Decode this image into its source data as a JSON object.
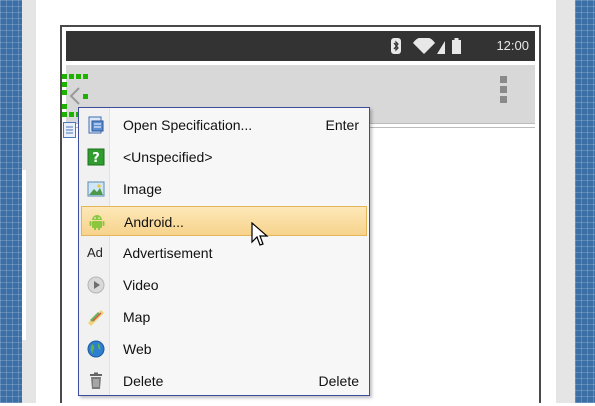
{
  "status_bar": {
    "clock": "12:00"
  },
  "context_menu": {
    "items": [
      {
        "label": "Open Specification...",
        "shortcut": "Enter",
        "icon": "specification-icon"
      },
      {
        "label": "<Unspecified>",
        "shortcut": "",
        "icon": "question-icon"
      },
      {
        "label": "Image",
        "shortcut": "",
        "icon": "image-icon"
      },
      {
        "label": "Android...",
        "shortcut": "",
        "icon": "android-icon",
        "highlighted": true
      },
      {
        "label": "Advertisement",
        "shortcut": "",
        "icon": "ad-icon",
        "icon_text": "Ad"
      },
      {
        "label": "Video",
        "shortcut": "",
        "icon": "play-icon"
      },
      {
        "label": "Map",
        "shortcut": "",
        "icon": "map-icon"
      },
      {
        "label": "Web",
        "shortcut": "",
        "icon": "globe-icon"
      },
      {
        "label": "Delete",
        "shortcut": "Delete",
        "icon": "trash-icon"
      }
    ]
  },
  "colors": {
    "canvas_grid": "#3c6fa6",
    "status_bar": "#333333",
    "action_bar": "#d8d8d8",
    "menu_border": "#3d4c9c",
    "highlight": "#f7d38c",
    "selection_handle": "#1fb100"
  }
}
